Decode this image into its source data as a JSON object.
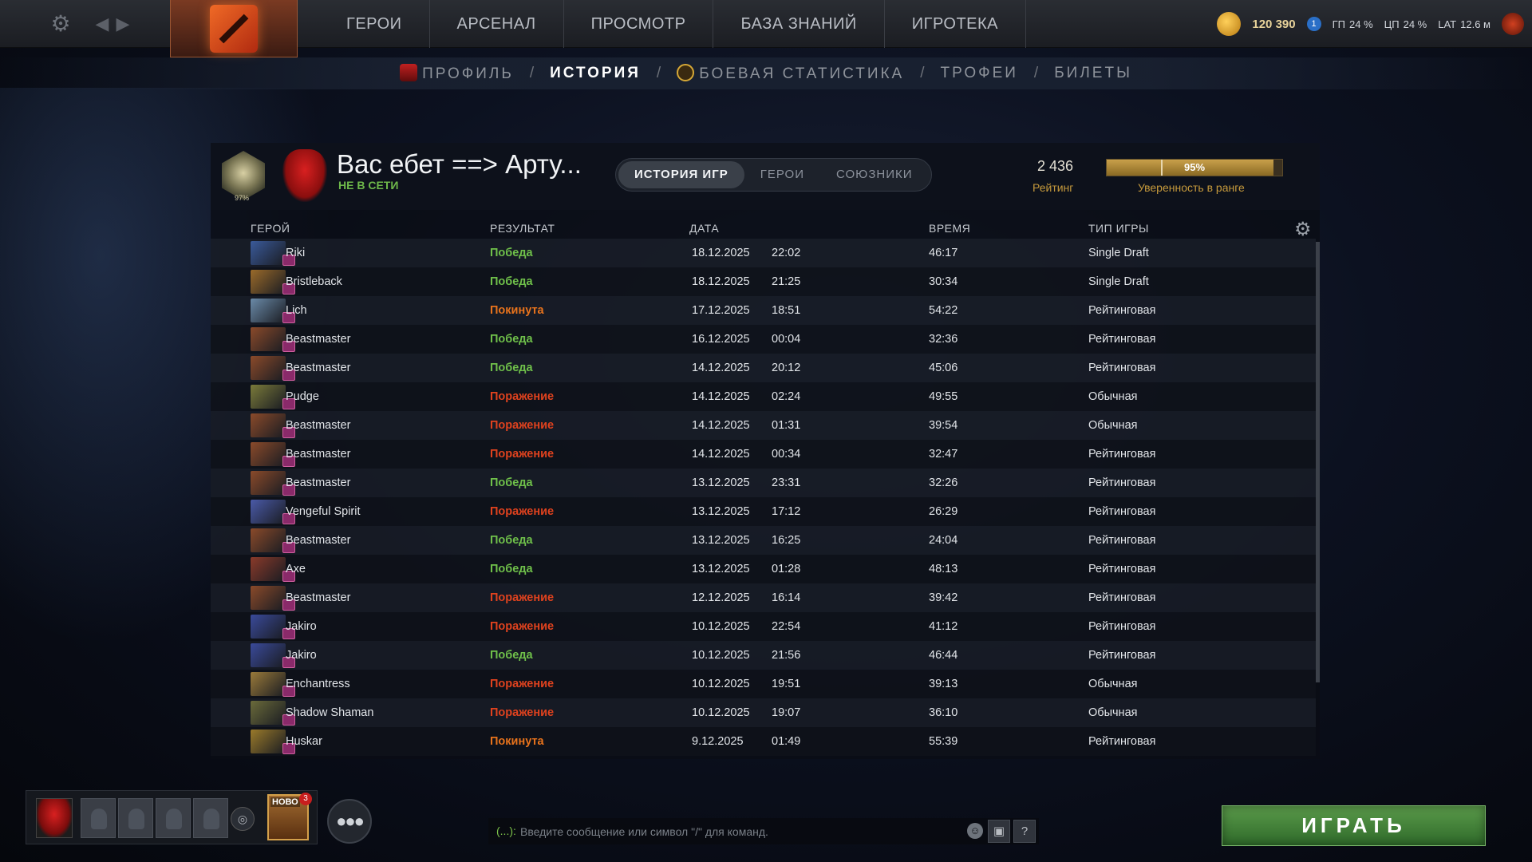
{
  "topbar": {
    "nav": [
      "ГЕРОИ",
      "АРСЕНАЛ",
      "ПРОСМОТР",
      "БАЗА ЗНАНИЙ",
      "ИГРОТЕКА"
    ],
    "coins": "120 390",
    "gpu_label": "ГП",
    "gpu_value": "24 %",
    "cpu_label": "ЦП",
    "cpu_value": "24 %",
    "lat_label": "LAT",
    "lat_value": "12.6 м",
    "badge_count": "1"
  },
  "subnav": {
    "profile": "ПРОФИЛЬ",
    "history": "ИСТОРИЯ",
    "battle_stats": "БОЕВАЯ СТАТИСТИКА",
    "trophies": "ТРОФЕИ",
    "tickets": "БИЛЕТЫ",
    "separator": "/"
  },
  "profile": {
    "name": "Вас ебет ==> Арту...",
    "status": "НЕ В СЕТИ",
    "rank_percent": "97%",
    "rating": "2 436",
    "rating_label": "Рейтинг",
    "confidence": "95%",
    "confidence_fraction": 0.95,
    "confidence_label": "Уверенность в ранге"
  },
  "tabs": [
    "ИСТОРИЯ ИГР",
    "ГЕРОИ",
    "СОЮЗНИКИ"
  ],
  "columns": {
    "hero": "ГЕРОЙ",
    "result": "РЕЗУЛЬТАТ",
    "date": "ДАТА",
    "time": "ВРЕМЯ",
    "type": "ТИП ИГРЫ"
  },
  "matches": [
    {
      "hero": "Riki",
      "result": "Победа",
      "outcome": "win",
      "date": "18.12.2025",
      "clock": "22:02",
      "duration": "46:17",
      "mode": "Single Draft",
      "color": "#3a5a9a"
    },
    {
      "hero": "Bristleback",
      "result": "Победа",
      "outcome": "win",
      "date": "18.12.2025",
      "clock": "21:25",
      "duration": "30:34",
      "mode": "Single Draft",
      "color": "#9a6a2a"
    },
    {
      "hero": "Lich",
      "result": "Покинута",
      "outcome": "left",
      "date": "17.12.2025",
      "clock": "18:51",
      "duration": "54:22",
      "mode": "Рейтинговая",
      "color": "#6a8aa8"
    },
    {
      "hero": "Beastmaster",
      "result": "Победа",
      "outcome": "win",
      "date": "16.12.2025",
      "clock": "00:04",
      "duration": "32:36",
      "mode": "Рейтинговая",
      "color": "#8a4a2a"
    },
    {
      "hero": "Beastmaster",
      "result": "Победа",
      "outcome": "win",
      "date": "14.12.2025",
      "clock": "20:12",
      "duration": "45:06",
      "mode": "Рейтинговая",
      "color": "#8a4a2a"
    },
    {
      "hero": "Pudge",
      "result": "Поражение",
      "outcome": "loss",
      "date": "14.12.2025",
      "clock": "02:24",
      "duration": "49:55",
      "mode": "Обычная",
      "color": "#7a7a3a"
    },
    {
      "hero": "Beastmaster",
      "result": "Поражение",
      "outcome": "loss",
      "date": "14.12.2025",
      "clock": "01:31",
      "duration": "39:54",
      "mode": "Обычная",
      "color": "#8a4a2a"
    },
    {
      "hero": "Beastmaster",
      "result": "Поражение",
      "outcome": "loss",
      "date": "14.12.2025",
      "clock": "00:34",
      "duration": "32:47",
      "mode": "Рейтинговая",
      "color": "#8a4a2a"
    },
    {
      "hero": "Beastmaster",
      "result": "Победа",
      "outcome": "win",
      "date": "13.12.2025",
      "clock": "23:31",
      "duration": "32:26",
      "mode": "Рейтинговая",
      "color": "#8a4a2a"
    },
    {
      "hero": "Vengeful Spirit",
      "result": "Поражение",
      "outcome": "loss",
      "date": "13.12.2025",
      "clock": "17:12",
      "duration": "26:29",
      "mode": "Рейтинговая",
      "color": "#4a5aa8"
    },
    {
      "hero": "Beastmaster",
      "result": "Победа",
      "outcome": "win",
      "date": "13.12.2025",
      "clock": "16:25",
      "duration": "24:04",
      "mode": "Рейтинговая",
      "color": "#8a4a2a"
    },
    {
      "hero": "Axe",
      "result": "Победа",
      "outcome": "win",
      "date": "13.12.2025",
      "clock": "01:28",
      "duration": "48:13",
      "mode": "Рейтинговая",
      "color": "#8a3a2a"
    },
    {
      "hero": "Beastmaster",
      "result": "Поражение",
      "outcome": "loss",
      "date": "12.12.2025",
      "clock": "16:14",
      "duration": "39:42",
      "mode": "Рейтинговая",
      "color": "#8a4a2a"
    },
    {
      "hero": "Jakiro",
      "result": "Поражение",
      "outcome": "loss",
      "date": "10.12.2025",
      "clock": "22:54",
      "duration": "41:12",
      "mode": "Рейтинговая",
      "color": "#3a4a9a"
    },
    {
      "hero": "Jakiro",
      "result": "Победа",
      "outcome": "win",
      "date": "10.12.2025",
      "clock": "21:56",
      "duration": "46:44",
      "mode": "Рейтинговая",
      "color": "#3a4a9a"
    },
    {
      "hero": "Enchantress",
      "result": "Поражение",
      "outcome": "loss",
      "date": "10.12.2025",
      "clock": "19:51",
      "duration": "39:13",
      "mode": "Обычная",
      "color": "#9a7a3a"
    },
    {
      "hero": "Shadow Shaman",
      "result": "Поражение",
      "outcome": "loss",
      "date": "10.12.2025",
      "clock": "19:07",
      "duration": "36:10",
      "mode": "Обычная",
      "color": "#6a6a3a"
    },
    {
      "hero": "Huskar",
      "result": "Покинута",
      "outcome": "left",
      "date": "9.12.2025",
      "clock": "01:49",
      "duration": "55:39",
      "mode": "Рейтинговая",
      "color": "#9a7a2a"
    }
  ],
  "bottom": {
    "news_label": "НОВО",
    "news_count": "3",
    "chat_prefix": "(...):",
    "chat_placeholder": "Введите сообщение или символ \"/\" для команд.",
    "help": "?",
    "play": "ИГРАТЬ"
  },
  "colors": {
    "win": "#6fc04a",
    "loss": "#e0421e",
    "left": "#e8731c",
    "accent_gold": "#c69a3c",
    "play_green": "#3f7a34"
  }
}
